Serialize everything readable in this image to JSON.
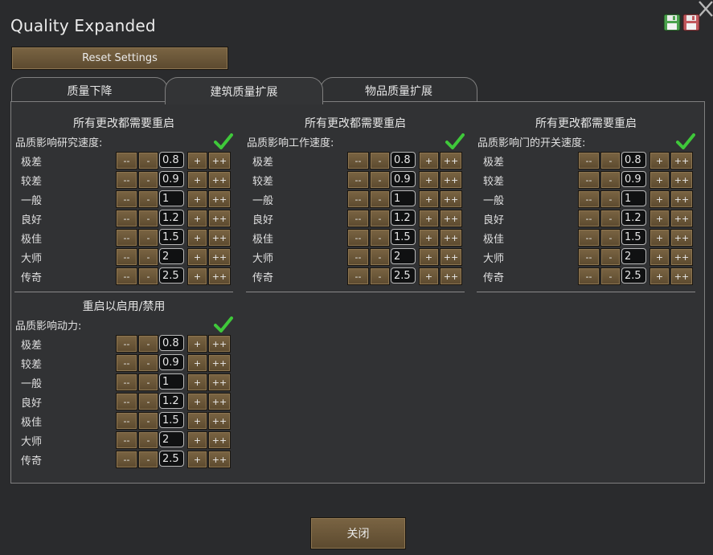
{
  "window": {
    "title": "Quality Expanded"
  },
  "toolbar": {
    "reset_label": "Reset Settings"
  },
  "tabs": [
    {
      "label": "质量下降"
    },
    {
      "label": "建筑质量扩展",
      "active": true
    },
    {
      "label": "物品质量扩展"
    }
  ],
  "buttons": {
    "dec2": "--",
    "dec1": "-",
    "inc1": "+",
    "inc2": "++"
  },
  "quality_levels": [
    "极差",
    "较差",
    "一般",
    "良好",
    "极佳",
    "大师",
    "传奇"
  ],
  "sections": [
    {
      "header": "所有更改都需要重启",
      "label": "品质影响研究速度:",
      "enabled": true,
      "values": [
        "0.8",
        "0.9",
        "1",
        "1.2",
        "1.5",
        "2",
        "2.5"
      ]
    },
    {
      "header": "所有更改都需要重启",
      "label": "品质影响工作速度:",
      "enabled": true,
      "values": [
        "0.8",
        "0.9",
        "1",
        "1.2",
        "1.5",
        "2",
        "2.5"
      ]
    },
    {
      "header": "所有更改都需要重启",
      "label": "品质影响门的开关速度:",
      "enabled": true,
      "values": [
        "0.8",
        "0.9",
        "1",
        "1.2",
        "1.5",
        "2",
        "2.5"
      ]
    },
    {
      "header": "重启以启用/禁用",
      "label": "品质影响动力:",
      "enabled": true,
      "values": [
        "0.8",
        "0.9",
        "1",
        "1.2",
        "1.5",
        "2",
        "2.5"
      ]
    }
  ],
  "footer": {
    "close_label": "关闭"
  },
  "colors": {
    "check": "#3fc83a",
    "button": "#6b5638",
    "panel": "#313234"
  },
  "icons": {
    "close": "close-icon",
    "save": "save-icon",
    "delete": "delete-save-icon",
    "check": "checkmark-icon"
  }
}
